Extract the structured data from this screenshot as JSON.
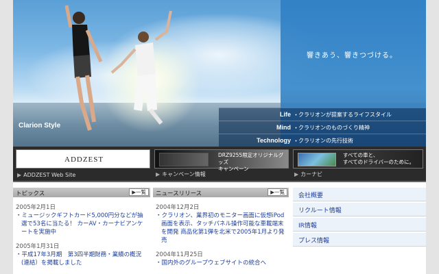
{
  "hero": {
    "tagline": "響きあう、響きつづける。",
    "brand_style": "Clarion Style",
    "rows": [
      {
        "key": "Life",
        "desc": "クラリオンが提案するライフスタイル"
      },
      {
        "key": "Mind",
        "desc": "クラリオンのものづくり精神"
      },
      {
        "key": "Technology",
        "desc": "クラリオンの先行技術"
      }
    ]
  },
  "banners": [
    {
      "logo": "ADDZEST",
      "caption": "ADDZEST Web Site"
    },
    {
      "text_line1": "DRZ9255限定オリジナルグッズ",
      "text_line2": "キャンペーン",
      "caption": "キャンペーン情報"
    },
    {
      "text_line1": "すべての車と、",
      "text_line2": "すべてのドライバーのために。",
      "caption": "カーナビ"
    }
  ],
  "topics": {
    "title": "トピックス",
    "all_label": "一覧",
    "items": [
      {
        "date": "2005年2月1日",
        "body": "ミュージックギフトカード5,000円分などが抽選で53名に当たる！ カーAV・カーナビアンケートを実施中"
      },
      {
        "date": "2005年1月31日",
        "body": "平成17年3月期　第3四半期財務・業績の概況(連結）を掲載しました"
      }
    ]
  },
  "news": {
    "title": "ニュースリリース",
    "all_label": "一覧",
    "items": [
      {
        "date": "2004年12月2日",
        "body": "クラリオン、業界初のモニター画面に仮想iPod画面を表示、タッチパネル操作可能な車載端末を開発 商品化第1弾を北米で2005年1月より発売"
      },
      {
        "date": "2004年11月25日",
        "body": "国内外のグループウェブサイトの統合へ"
      }
    ]
  },
  "side_links": [
    "会社概要",
    "リクルート情報",
    "IR情報",
    "プレス情報"
  ],
  "glyphs": {
    "arrow": "▶",
    "bullet": "・"
  }
}
